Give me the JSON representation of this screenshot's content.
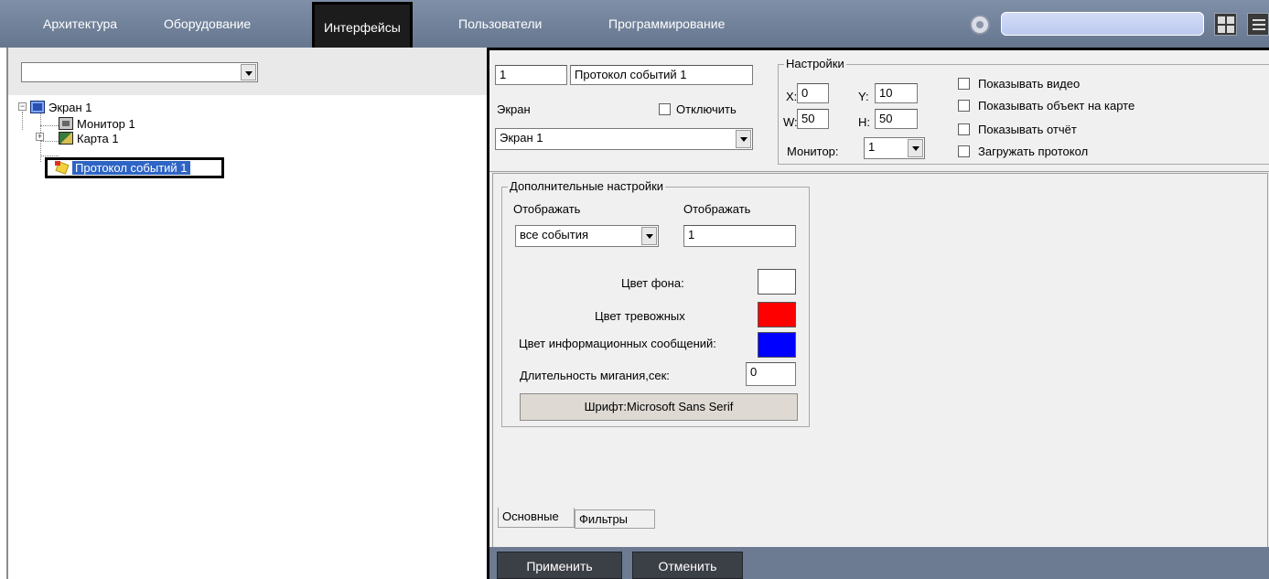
{
  "menu": {
    "items": [
      "Архитектура",
      "Оборудование",
      "Интерфейсы",
      "Пользователи",
      "Программирование"
    ],
    "active_index": 2
  },
  "tree": {
    "combo_value": "",
    "items": [
      {
        "label": "Экран 1",
        "icon": "screen-icon"
      },
      {
        "label": "Монитор 1",
        "icon": "monitor-icon"
      },
      {
        "label": "Карта 1",
        "icon": "map-icon"
      },
      {
        "label": "Протокол событий 1",
        "icon": "event-log-icon"
      }
    ]
  },
  "props": {
    "id_value": "1",
    "name_value": "Протокол событий 1",
    "screen_label": "Экран",
    "disable_label": "Отключить",
    "screen_value": "Экран 1",
    "settings_title": "Настройки",
    "x_label": "X:",
    "x_value": "0",
    "y_label": "Y:",
    "y_value": "10",
    "w_label": "W:",
    "w_value": "50",
    "h_label": "H:",
    "h_value": "50",
    "monitor_label": "Монитор:",
    "monitor_value": "1",
    "checkboxes": [
      "Показывать видео",
      "Показывать объект на карте",
      "Показывать отчёт",
      "Загружать протокол"
    ]
  },
  "extra": {
    "title": "Дополнительные настройки",
    "display_label_1": "Отображать",
    "display_label_2": "Отображать",
    "events_value": "все события",
    "count_value": "1",
    "bg_color_label": "Цвет фона:",
    "alarm_color_label": "Цвет тревожных",
    "info_color_label": "Цвет информационных сообщений:",
    "blink_label": "Длительность мигания,сек:",
    "blink_value": "0",
    "font_button": "Шрифт:Microsoft Sans Serif",
    "colors": {
      "background": "#ffffff",
      "alarm": "#ff0000",
      "info": "#0000ff"
    }
  },
  "tabs": [
    "Основные",
    "Фильтры"
  ],
  "actions": {
    "apply": "Применить",
    "cancel": "Отменить"
  }
}
